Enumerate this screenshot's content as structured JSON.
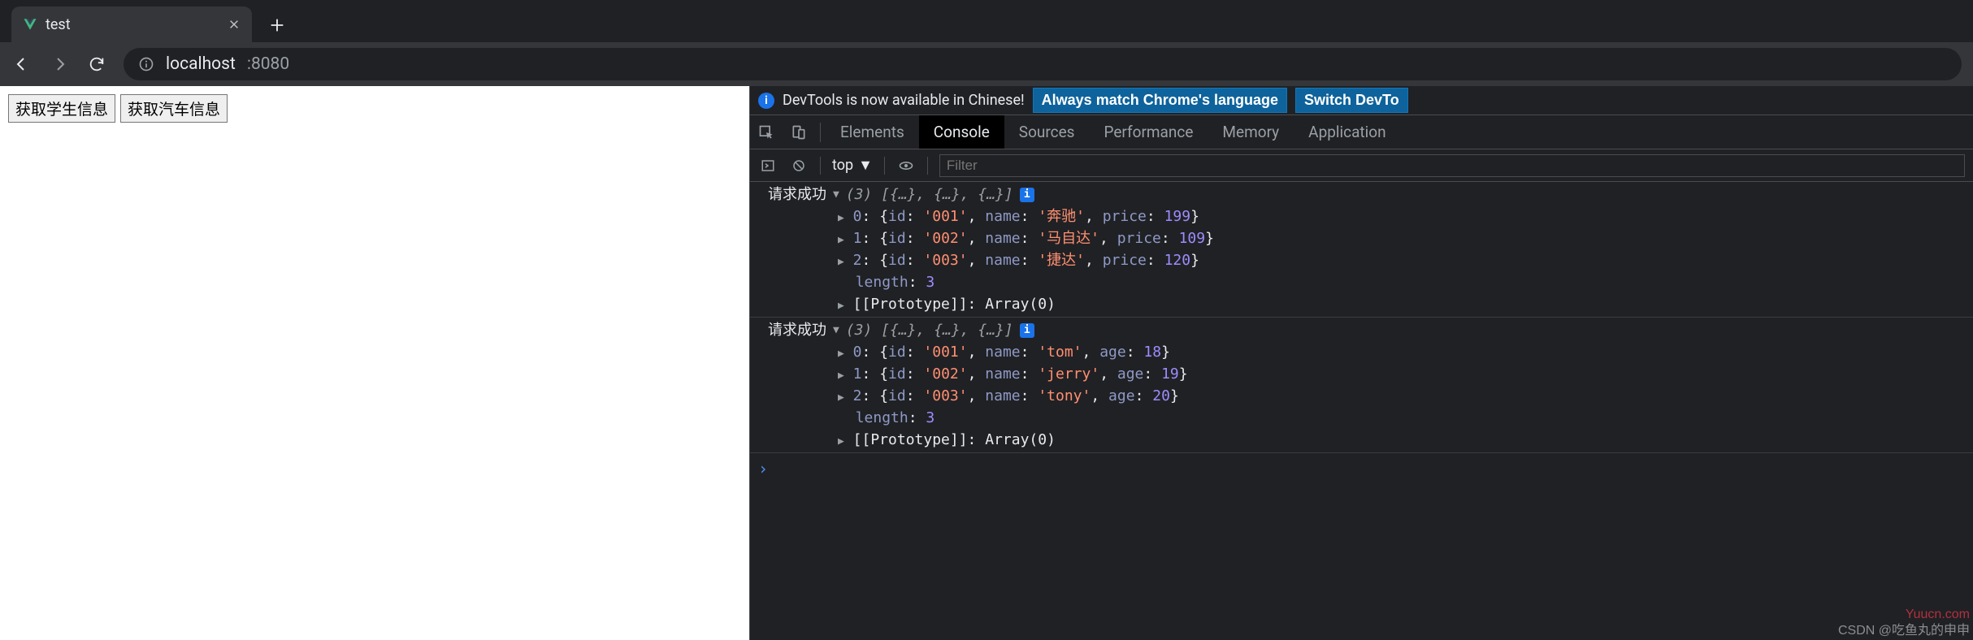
{
  "browser": {
    "tab_title": "test",
    "url_host": "localhost",
    "url_port": ":8080"
  },
  "page": {
    "button_students": "获取学生信息",
    "button_cars": "获取汽车信息"
  },
  "devtools": {
    "banner_text": "DevTools is now available in Chinese!",
    "banner_btn_match": "Always match Chrome's language",
    "banner_btn_switch": "Switch DevTo",
    "tabs": {
      "elements": "Elements",
      "console": "Console",
      "sources": "Sources",
      "performance": "Performance",
      "memory": "Memory",
      "application": "Application"
    },
    "console_toolbar": {
      "context": "top",
      "filter_placeholder": "Filter"
    },
    "logs": [
      {
        "label": "请求成功",
        "summary": "(3) [{…}, {…}, {…}]",
        "items": [
          {
            "idx": "0",
            "body": "{id: '001', name: '奔驰', price: 199}"
          },
          {
            "idx": "1",
            "body": "{id: '002', name: '马自达', price: 109}"
          },
          {
            "idx": "2",
            "body": "{id: '003', name: '捷达', price: 120}"
          }
        ],
        "length_line": "length: 3",
        "proto_line": "[[Prototype]]: Array(0)",
        "data": [
          {
            "id": "001",
            "name": "奔驰",
            "price": 199
          },
          {
            "id": "002",
            "name": "马自达",
            "price": 109
          },
          {
            "id": "003",
            "name": "捷达",
            "price": 120
          }
        ]
      },
      {
        "label": "请求成功",
        "summary": "(3) [{…}, {…}, {…}]",
        "items": [
          {
            "idx": "0",
            "body": "{id: '001', name: 'tom', age: 18}"
          },
          {
            "idx": "1",
            "body": "{id: '002', name: 'jerry', age: 19}"
          },
          {
            "idx": "2",
            "body": "{id: '003', name: 'tony', age: 20}"
          }
        ],
        "length_line": "length: 3",
        "proto_line": "[[Prototype]]: Array(0)",
        "data": [
          {
            "id": "001",
            "name": "tom",
            "age": 18
          },
          {
            "id": "002",
            "name": "jerry",
            "age": 19
          },
          {
            "id": "003",
            "name": "tony",
            "age": 20
          }
        ]
      }
    ],
    "watermark_red": "Yuucn.com",
    "watermark_gray": "CSDN @吃鱼丸的申申"
  }
}
